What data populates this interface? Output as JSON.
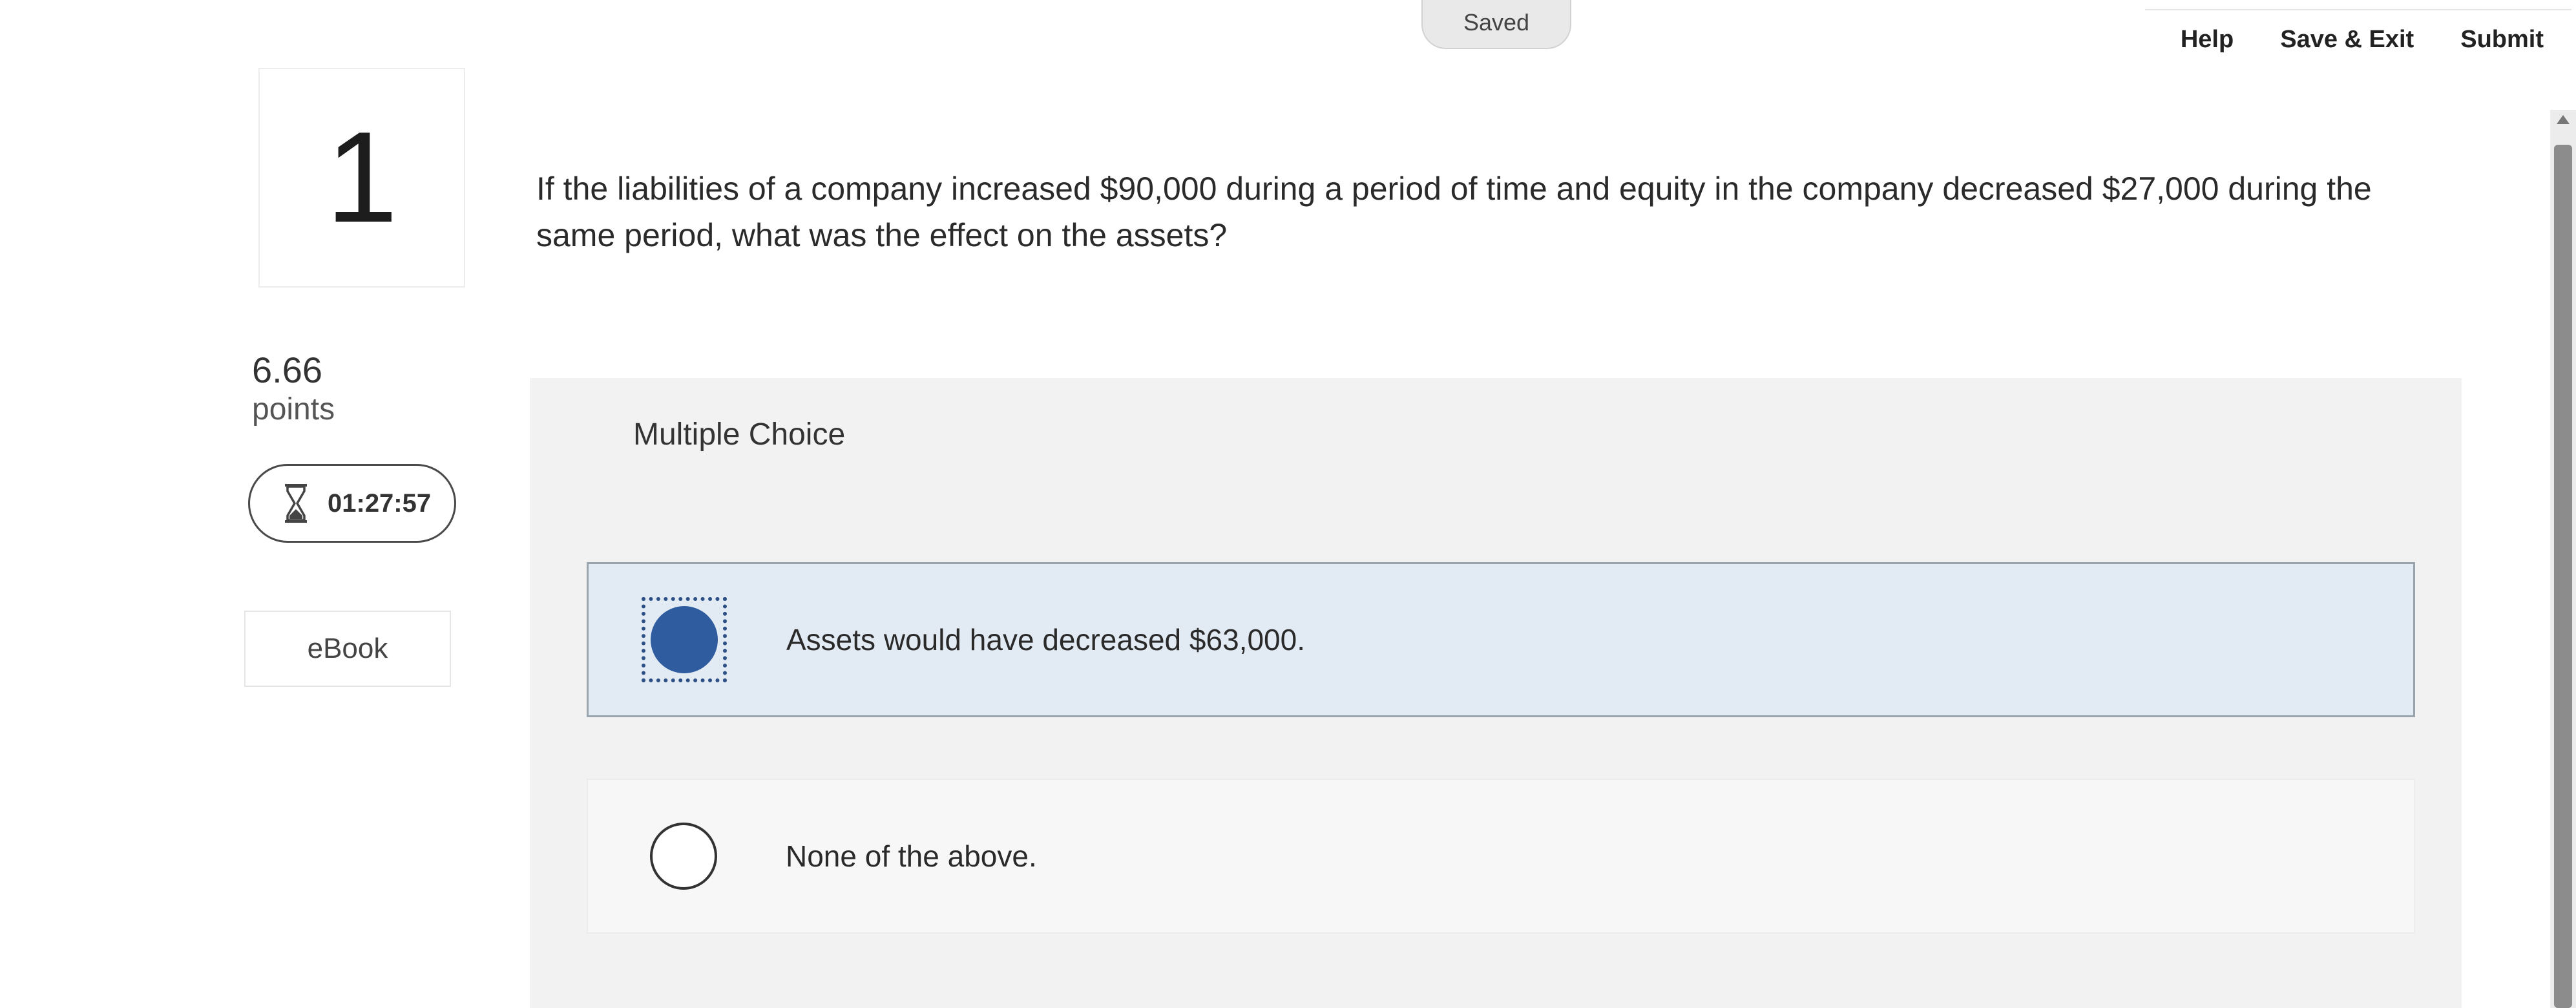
{
  "header": {
    "status": "Saved",
    "help_label": "Help",
    "save_exit_label": "Save & Exit",
    "submit_label": "Submit"
  },
  "question": {
    "number": "1",
    "points_value": "6.66",
    "points_label": "points",
    "timer": "01:27:57",
    "ebook_label": "eBook",
    "prompt": "If the liabilities of a company increased $90,000 during a period of time and equity in the company decreased $27,000 during the same period, what was the effect on the assets?"
  },
  "answers": {
    "heading": "Multiple Choice",
    "choices": [
      {
        "label": "Assets would have decreased $63,000.",
        "selected": true
      },
      {
        "label": "None of the above.",
        "selected": false
      }
    ]
  },
  "colors": {
    "selected_radio": "#2f5c9f",
    "selected_choice_bg": "#e2eaf3",
    "panel_bg": "#f2f2f2"
  },
  "icons": {
    "timer": "hourglass-icon"
  }
}
